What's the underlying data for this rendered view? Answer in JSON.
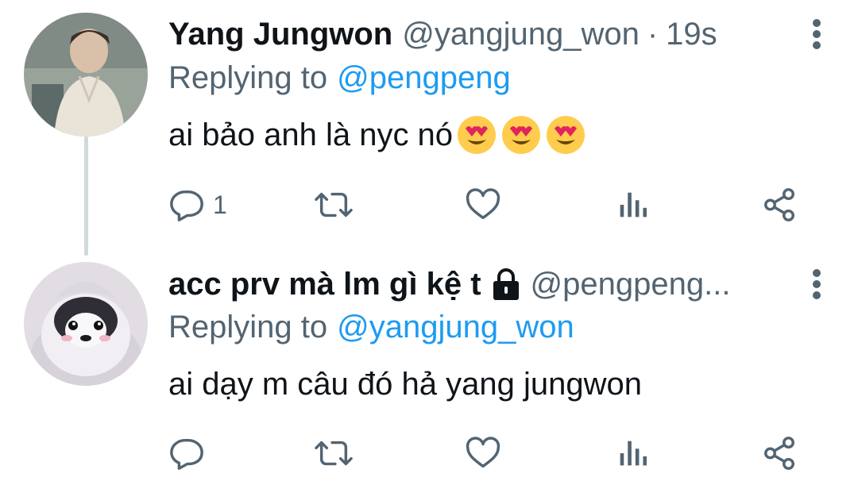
{
  "tweets": [
    {
      "display_name": "Yang Jungwon",
      "handle": "@yangjung_won",
      "separator": "·",
      "time": "19s",
      "replying_label": "Replying to",
      "replying_to": "@pengpeng",
      "text": "ai bảo anh là nyc nó",
      "emoji": [
        "heart-eyes-emoji",
        "heart-eyes-emoji",
        "heart-eyes-emoji"
      ],
      "reply_count": "1"
    },
    {
      "display_name": "acc prv mà lm gì kệ t",
      "handle": "@pengpeng...",
      "replying_label": "Replying to",
      "replying_to": "@yangjung_won",
      "text": "ai dạy m câu đó hả yang jungwon",
      "protected_icon": "lock-icon"
    }
  ],
  "colors": {
    "text": "#0f1419",
    "secondary": "#536471",
    "link": "#1d9bf0",
    "thread_line": "#cfd9de"
  },
  "icons": [
    "reply-icon",
    "retweet-icon",
    "like-icon",
    "analytics-icon",
    "share-icon",
    "more-icon"
  ]
}
